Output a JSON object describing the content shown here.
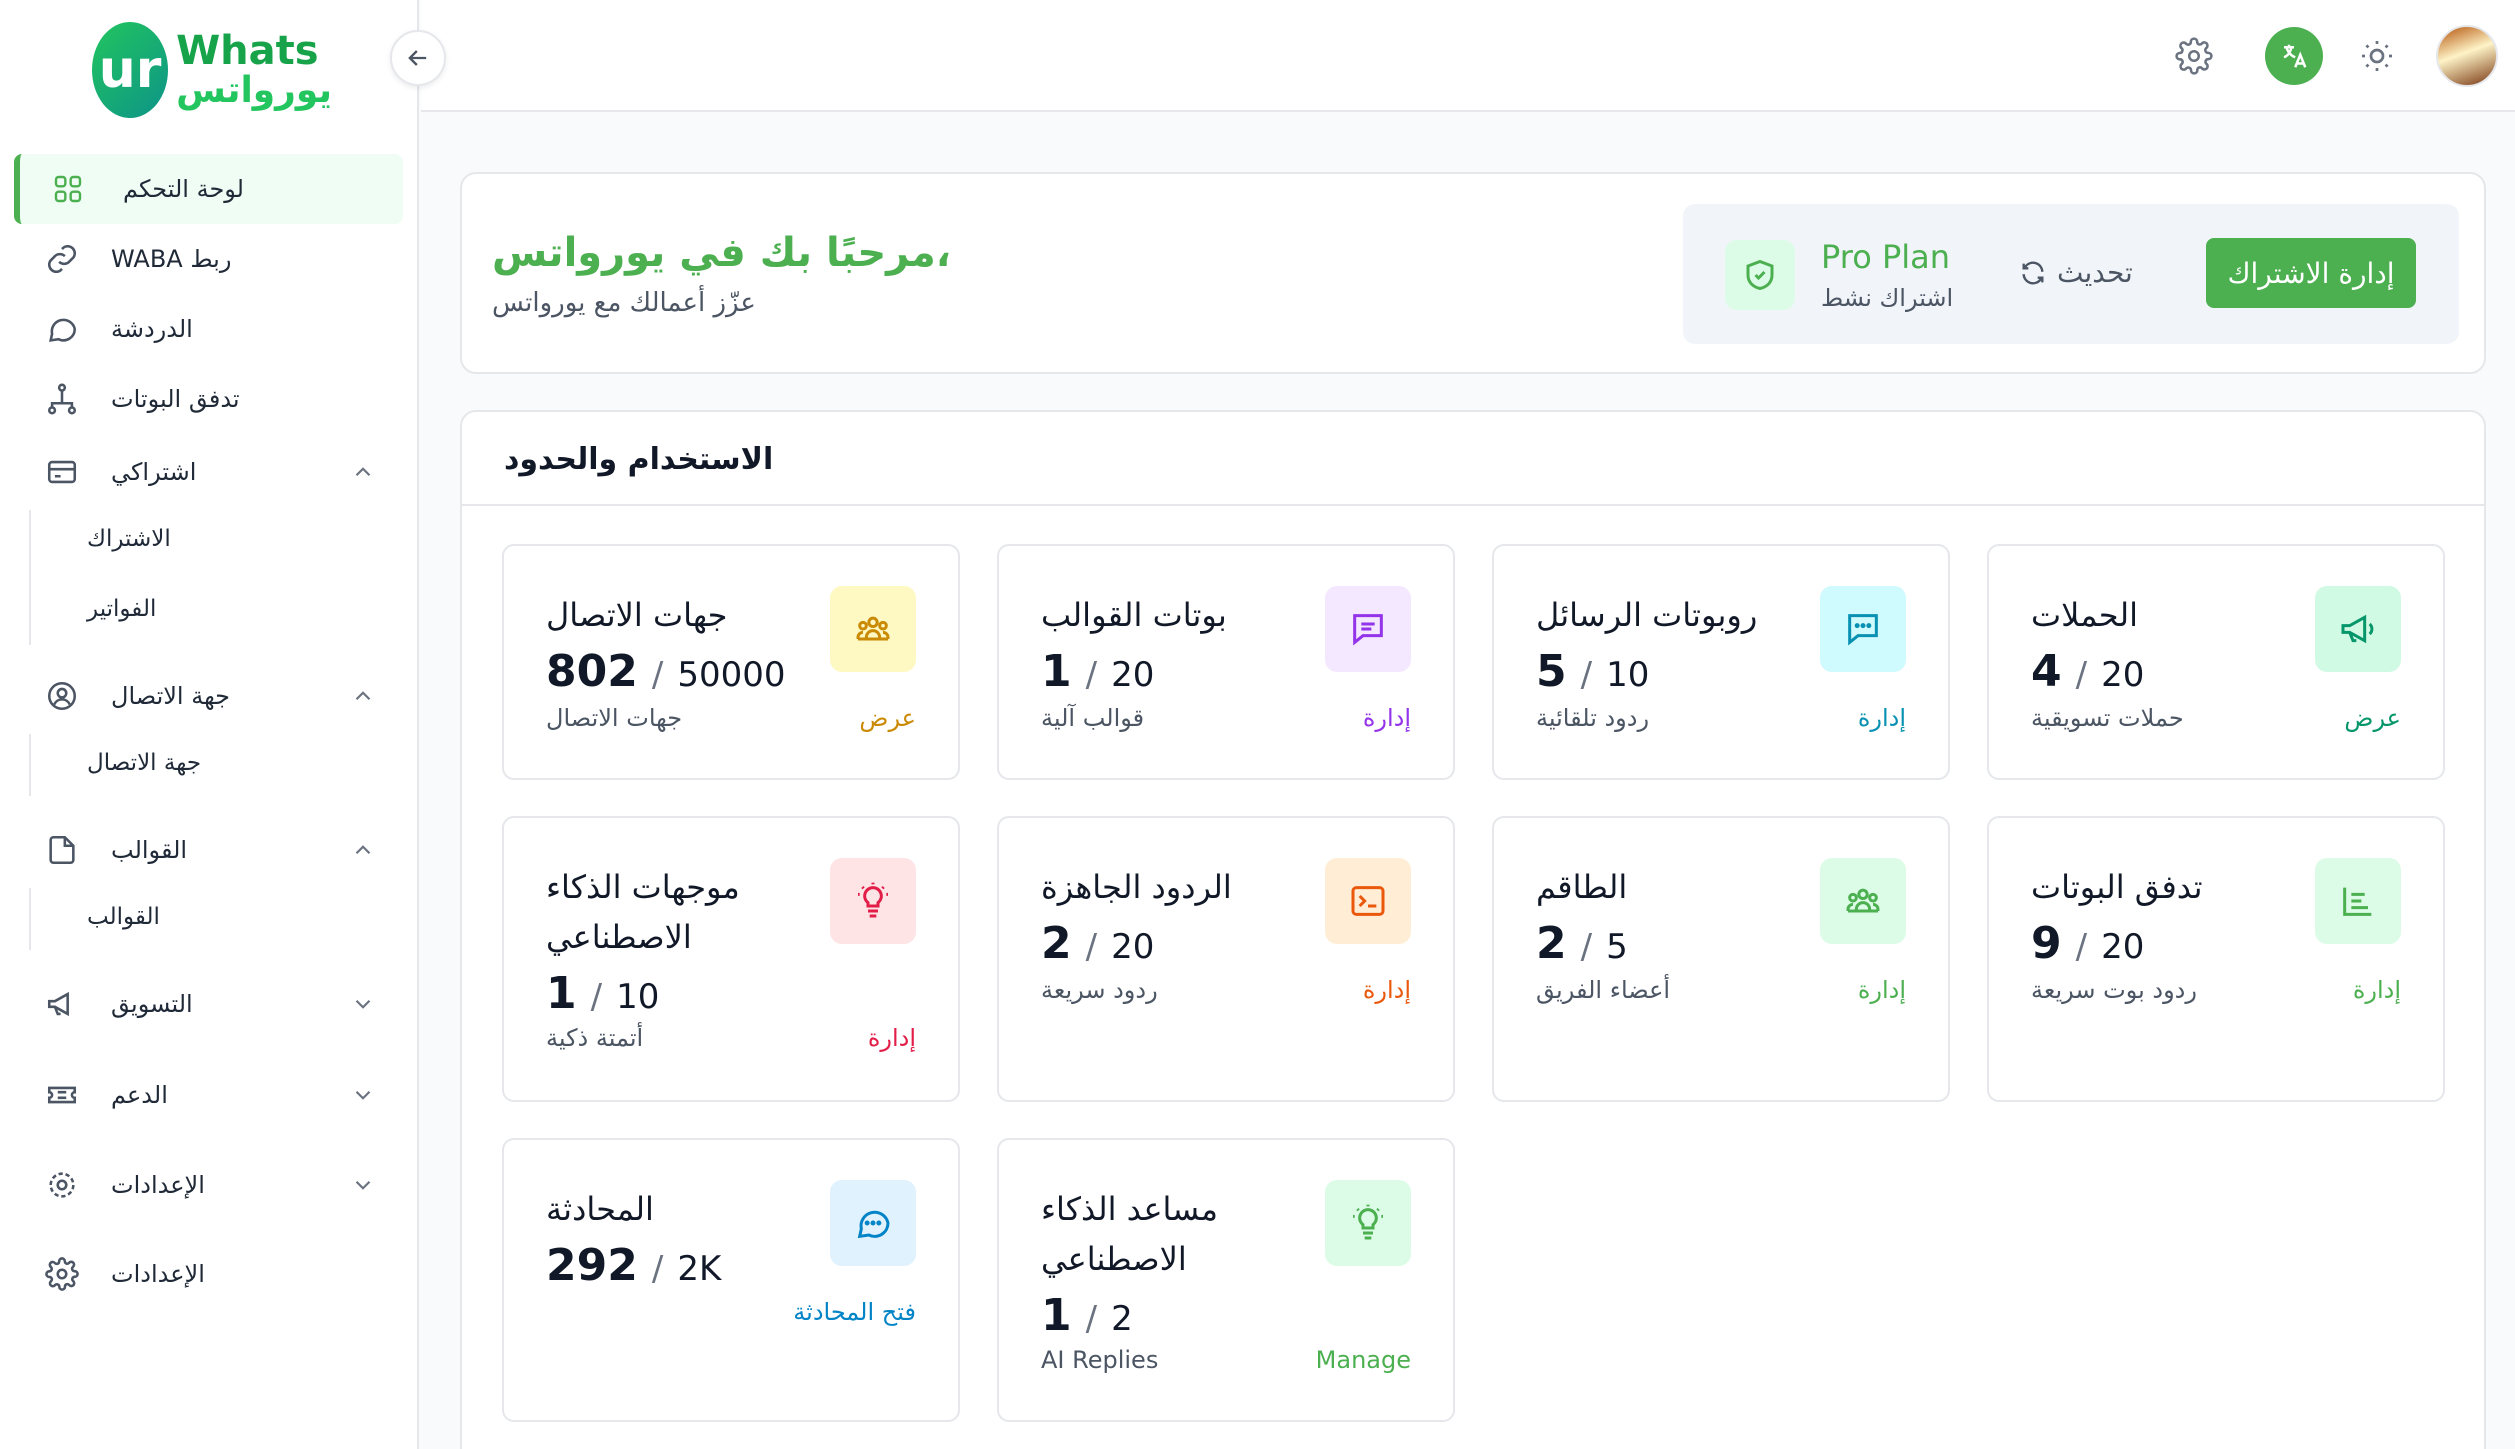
{
  "brand": {
    "mark": "ur",
    "name_en": "Whats",
    "name_ar": "يورواتس"
  },
  "sidebar": {
    "items": [
      {
        "label": "لوحة التحكم",
        "icon": "grid-icon"
      },
      {
        "label": "WABA ربط",
        "icon": "link-icon"
      },
      {
        "label": "الدردشة",
        "icon": "chat-bubble-icon"
      },
      {
        "label": "تدفق البوتات",
        "icon": "flow-icon"
      },
      {
        "label": "اشتراكي",
        "icon": "credit-card-icon"
      },
      {
        "label": "جهة الاتصال",
        "icon": "user-circle-icon"
      },
      {
        "label": "القوالب",
        "icon": "file-icon"
      },
      {
        "label": "التسويق",
        "icon": "megaphone-icon"
      },
      {
        "label": "الدعم",
        "icon": "ticket-icon"
      },
      {
        "label": "الإعدادات",
        "icon": "cog-icon"
      },
      {
        "label": "الإعدادات",
        "icon": "settings-icon"
      }
    ],
    "sub_subscription": [
      "الاشتراك",
      "الفواتير"
    ],
    "sub_contact": [
      "جهة الاتصال"
    ],
    "sub_templates": [
      "القوالب"
    ]
  },
  "header": {
    "icons": [
      "settings-icon",
      "translate-icon",
      "sun-icon",
      "avatar"
    ]
  },
  "welcome": {
    "title": "مرحبًا بك في يورواتس،",
    "subtitle": "عزّز أعمالك مع يورواتس",
    "plan_name": "Pro Plan",
    "plan_status": "اشتراك نشط",
    "refresh_label": "تحديث",
    "manage_label": "إدارة الاشتراك"
  },
  "usage": {
    "title": "الاستخدام والحدود",
    "cards": [
      {
        "title": "جهات الاتصال",
        "used": "802",
        "limit": "50000",
        "desc": "جهات الاتصال",
        "action": "عرض",
        "icon": "users-icon",
        "color": "#ca8a04",
        "bg": "#fef9c3"
      },
      {
        "title": "بوتات القوالب",
        "used": "1",
        "limit": "20",
        "desc": "قوالب آلية",
        "action": "إدارة",
        "icon": "message-square-icon",
        "color": "#9333ea",
        "bg": "#f3e8ff"
      },
      {
        "title": "روبوتات الرسائل",
        "used": "5",
        "limit": "10",
        "desc": "ردود تلقائية",
        "action": "إدارة",
        "icon": "message-dots-icon",
        "color": "#0891b2",
        "bg": "#cffafe"
      },
      {
        "title": "الحملات",
        "used": "4",
        "limit": "20",
        "desc": "حملات تسويقية",
        "action": "عرض",
        "icon": "megaphone-icon",
        "color": "#059669",
        "bg": "#d1fae5"
      },
      {
        "title": "موجهات الذكاء الاصطناعي",
        "used": "1",
        "limit": "10",
        "desc": "أتمتة ذكية",
        "action": "إدارة",
        "icon": "lightbulb-icon",
        "color": "#e11d48",
        "bg": "#ffe4e6"
      },
      {
        "title": "الردود الجاهزة",
        "used": "2",
        "limit": "20",
        "desc": "ردود سريعة",
        "action": "إدارة",
        "icon": "terminal-icon",
        "color": "#ea580c",
        "bg": "#ffedd5"
      },
      {
        "title": "الطاقم",
        "used": "2",
        "limit": "5",
        "desc": "أعضاء الفريق",
        "action": "إدارة",
        "icon": "team-icon",
        "color": "#4caf50",
        "bg": "#dcfce7"
      },
      {
        "title": "تدفق البوتات",
        "used": "9",
        "limit": "20",
        "desc": "ردود بوت سريعة",
        "action": "إدارة",
        "icon": "chart-list-icon",
        "color": "#4caf50",
        "bg": "#dcfce7"
      },
      {
        "title": "المحادثة",
        "used": "292",
        "limit": "2K",
        "desc": "",
        "action": "فتح المحادثة",
        "icon": "chat-dots-icon",
        "color": "#0284c7",
        "bg": "#e0f2fe"
      },
      {
        "title": "مساعد الذكاء الاصطناعي",
        "used": "1",
        "limit": "2",
        "desc": "AI Replies",
        "action": "Manage",
        "icon": "bulb-icon",
        "color": "#4caf50",
        "bg": "#dcfce7"
      }
    ]
  }
}
